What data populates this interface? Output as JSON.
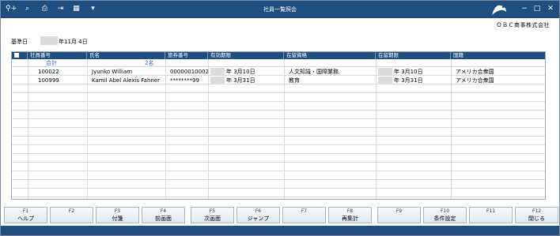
{
  "window": {
    "title": "社員一覧照会"
  },
  "toolbar": [
    {
      "name": "search-plus-icon",
      "glyph": "⚲+"
    },
    {
      "name": "zoom-icon",
      "glyph": "⌕"
    },
    {
      "name": "print-icon",
      "glyph": "⎙"
    },
    {
      "name": "export-icon",
      "glyph": "⇥"
    },
    {
      "name": "excel-icon",
      "glyph": "▦"
    },
    {
      "name": "dropdown-icon",
      "glyph": "▾"
    }
  ],
  "window_controls": [
    "−",
    "□",
    "✕"
  ],
  "company": "ＯＢＣ商事株式会社",
  "base_date": {
    "label": "基準日",
    "value_suffix": "年11月 4日"
  },
  "table": {
    "columns": [
      "社員番号",
      "氏名",
      "旅券番号",
      "有効期限",
      "在留資格",
      "在留期限",
      "国籍"
    ],
    "total": {
      "label": "合計",
      "count": "2名"
    },
    "rows": [
      [
        "100022",
        "Jyunko William",
        "00000010002",
        "年  3月10日",
        "人文知識・国際業務",
        "年  3月10日",
        "アメリカ合衆国"
      ],
      [
        "100999",
        "Kamil Abel Alexis Fahner",
        "********99",
        "年  3月31日",
        "教育",
        "年  3月31日",
        "アメリカ合衆国"
      ]
    ]
  },
  "fkeys": [
    {
      "num": "F1",
      "label": "ヘルプ"
    },
    {
      "num": "F2",
      "label": ""
    },
    {
      "num": "F3",
      "label": "付箋"
    },
    {
      "num": "F4",
      "label": "前画面"
    },
    {
      "num": "F5",
      "label": "次画面"
    },
    {
      "num": "F6",
      "label": "ジャンプ"
    },
    {
      "num": "F7",
      "label": ""
    },
    {
      "num": "F8",
      "label": "再集計"
    },
    {
      "num": "F9",
      "label": ""
    },
    {
      "num": "F10",
      "label": "条件設定"
    },
    {
      "num": "F11",
      "label": ""
    },
    {
      "num": "F12",
      "label": "閉じる"
    }
  ],
  "colors": {
    "accent": "#1f4f80",
    "total": "#1f5fd0"
  }
}
